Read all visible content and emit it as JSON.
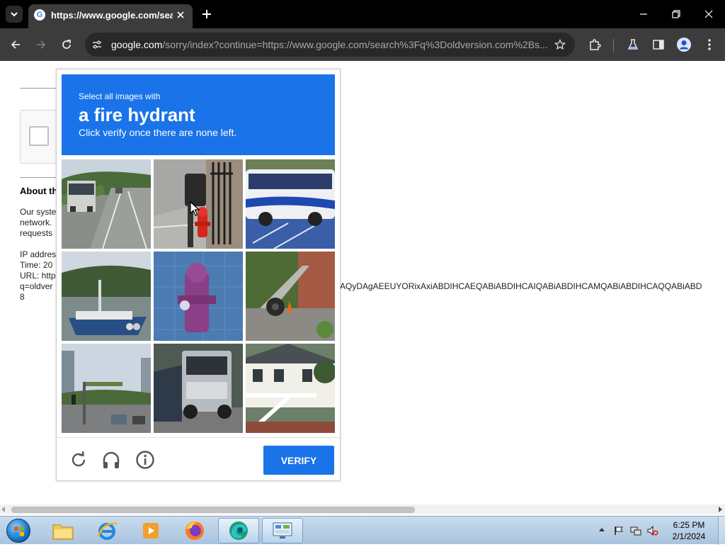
{
  "browser": {
    "tab_title": "https://www.google.com/search",
    "address_host": "google.com",
    "address_path": "/sorry/index?continue=https://www.google.com/search%3Fq%3Doldversion.com%2Bs..."
  },
  "page": {
    "about_heading": "About th",
    "about_text": "Our syste\nnetwork.\nrequests",
    "info_text": "IP addres\nTime: 20\nURL: http\nq=oldver\n8",
    "url_overflow": "AQyDAgAEEUYORixAxiABDIHCAEQABiABDIHCAIQABiABDIHCAMQABiABDIHCAQQABiABD"
  },
  "captcha": {
    "instruction_small": "Select all images with",
    "instruction_target": "a fire hydrant",
    "instruction_sub": "Click verify once there are none left.",
    "tiles": [
      {
        "description": "bus-on-highway"
      },
      {
        "description": "fire-hydrant-by-gate"
      },
      {
        "description": "blue-white-bus"
      },
      {
        "description": "ferry-boat-on-river"
      },
      {
        "description": "purple-fire-hydrant"
      },
      {
        "description": "brick-house-with-tire"
      },
      {
        "description": "street-intersection-traffic-light"
      },
      {
        "description": "truck-on-road"
      },
      {
        "description": "two-story-house-porch"
      }
    ],
    "verify_label": "VERIFY",
    "colors": {
      "header": "#1a73e8",
      "verify": "#1a73e8"
    }
  },
  "taskbar": {
    "apps": [
      "file-explorer",
      "internet-explorer",
      "media-player",
      "firefox",
      "edge",
      "control-panel"
    ],
    "clock_time": "6:25 PM",
    "clock_date": "2/1/2024"
  }
}
